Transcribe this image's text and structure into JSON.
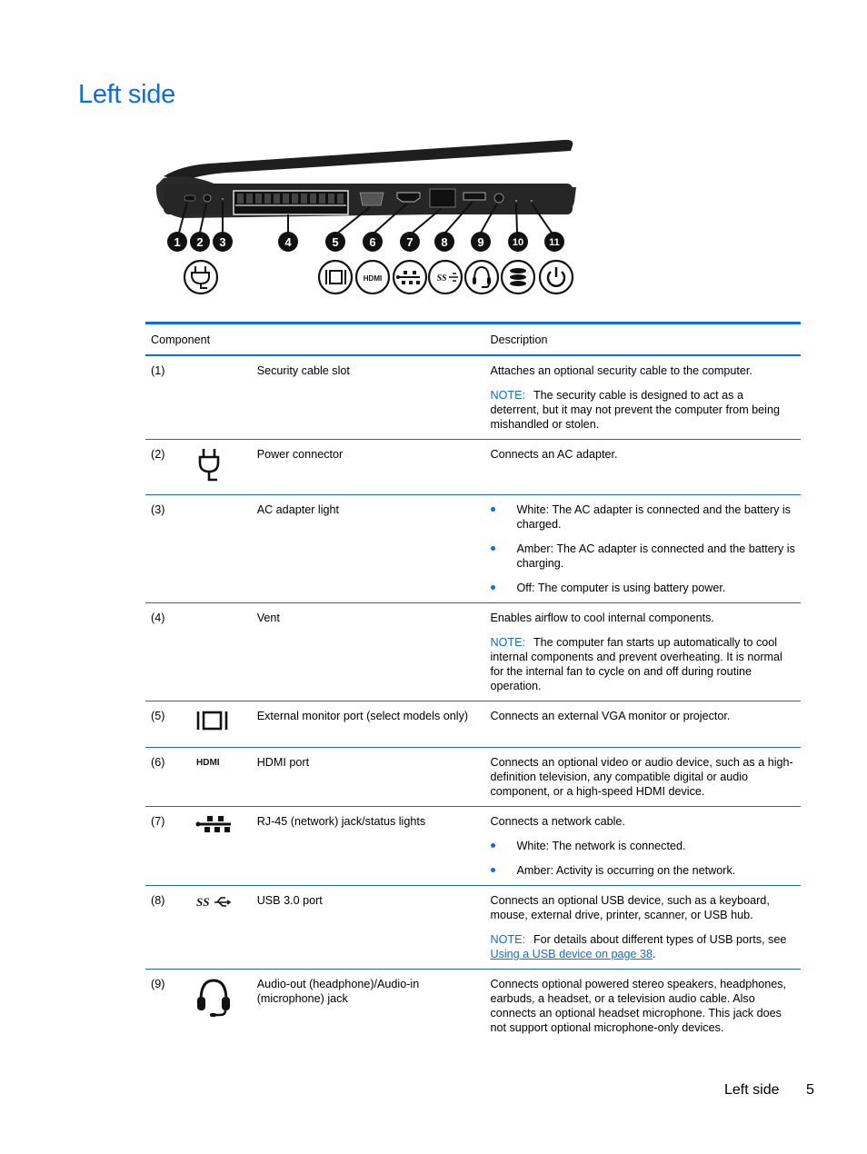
{
  "page": {
    "title": "Left side",
    "footer": {
      "section": "Left side",
      "page_number": "5"
    }
  },
  "figure": {
    "callouts": [
      "1",
      "2",
      "3",
      "4",
      "5",
      "6",
      "7",
      "8",
      "9",
      "10",
      "11"
    ],
    "icons": [
      "power-plug-icon",
      "vga-monitor-icon",
      "hdmi-icon",
      "network-icon",
      "usb-superspeed-icon",
      "headset-icon",
      "drive-activity-icon",
      "power-icon"
    ],
    "hdmi_text": "HDMI",
    "usb_text": "SS"
  },
  "table": {
    "headers": {
      "component": "Component",
      "description": "Description"
    },
    "note_label": "NOTE:",
    "rows": [
      {
        "num": "(1)",
        "icon": "",
        "name": "Security cable slot",
        "desc": "Attaches an optional security cable to the computer.",
        "note": "The security cable is designed to act as a deterrent, but it may not prevent the computer from being mishandled or stolen."
      },
      {
        "num": "(2)",
        "icon": "power-plug-icon",
        "name": "Power connector",
        "desc": "Connects an AC adapter."
      },
      {
        "num": "(3)",
        "icon": "",
        "name": "AC adapter light",
        "bullets": [
          "White: The AC adapter is connected and the battery is charged.",
          "Amber: The AC adapter is connected and the battery is charging.",
          "Off: The computer is using battery power."
        ]
      },
      {
        "num": "(4)",
        "icon": "",
        "name": "Vent",
        "desc": "Enables airflow to cool internal components.",
        "note": "The computer fan starts up automatically to cool internal components and prevent overheating. It is normal for the internal fan to cycle on and off during routine operation."
      },
      {
        "num": "(5)",
        "icon": "vga-monitor-icon",
        "name": "External monitor port (select models only)",
        "desc": "Connects an external VGA monitor or projector."
      },
      {
        "num": "(6)",
        "icon": "hdmi-icon",
        "name": "HDMI port",
        "desc": "Connects an optional video or audio device, such as a high-definition television, any compatible digital or audio component, or a high-speed HDMI device."
      },
      {
        "num": "(7)",
        "icon": "network-icon",
        "name": "RJ-45 (network) jack/status lights",
        "desc": "Connects a network cable.",
        "bullets": [
          "White: The network is connected.",
          "Amber: Activity is occurring on the network."
        ]
      },
      {
        "num": "(8)",
        "icon": "usb-superspeed-icon",
        "name": "USB 3.0 port",
        "desc": "Connects an optional USB device, such as a keyboard, mouse, external drive, printer, scanner, or USB hub.",
        "note": "For details about different types of USB ports, see",
        "note_link": "Using a USB device on page 38",
        "note_tail": "."
      },
      {
        "num": "(9)",
        "icon": "headset-icon",
        "name": "Audio-out (headphone)/Audio-in (microphone) jack",
        "desc": "Connects optional powered stereo speakers, headphones, earbuds, a headset, or a television audio cable. Also connects an optional headset microphone. This jack does not support optional microphone-only devices."
      }
    ]
  }
}
